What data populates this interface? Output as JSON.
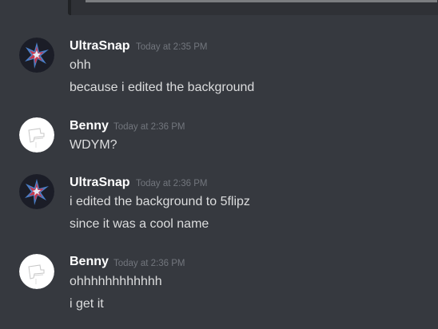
{
  "chat": {
    "messages": [
      {
        "author": "UltraSnap",
        "timestamp": "Today at 2:35 PM",
        "avatar": "ultrasnap-avatar",
        "lines": [
          "ohh",
          "because i edited the background"
        ]
      },
      {
        "author": "Benny",
        "timestamp": "Today at 2:36 PM",
        "avatar": "benny-avatar",
        "lines": [
          "WDYM?"
        ]
      },
      {
        "author": "UltraSnap",
        "timestamp": "Today at 2:36 PM",
        "avatar": "ultrasnap-avatar",
        "lines": [
          "i edited the background to 5flipz",
          "since it was a cool name"
        ]
      },
      {
        "author": "Benny",
        "timestamp": "Today at 2:36 PM",
        "avatar": "benny-avatar",
        "lines": [
          "ohhhhhhhhhhhh",
          "i get it"
        ]
      }
    ]
  },
  "colors": {
    "background": "#36393f",
    "username": "#ffffff",
    "message_text": "#dcddde",
    "timestamp": "#72767d"
  }
}
